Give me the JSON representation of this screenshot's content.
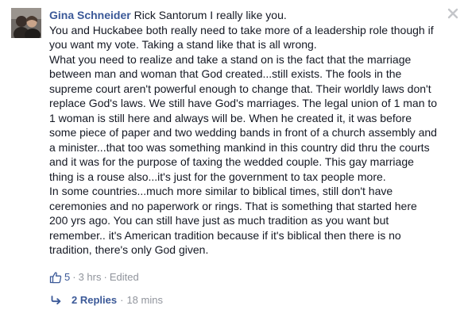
{
  "comment": {
    "author": "Gina Schneider",
    "lines": [
      "Rick Santorum I really like you.",
      "You and Huckabee both really need to take more of a leadership role though if",
      "you want my vote. Taking a stand like that is all wrong.",
      "What you need to realize and take a stand on is the fact that the marriage",
      "between man and woman that God created...still exists. The fools in the",
      "supreme court aren't powerful enough to change that. Their worldly laws don't",
      "replace God's laws. We still have God's marriages. The legal union of 1 man to",
      "1 woman is still here and always will be. When he created it, it was before",
      "some piece of paper and two wedding bands in front of a church assembly and",
      "a minister...that too was something mankind in this country did thru the courts",
      "and it was for the purpose of taxing the wedded couple. This gay marriage",
      "thing is a rouse also...it's just for the government to tax people more.",
      "In some countries...much more similar to biblical times, still don't have",
      "ceremonies and no paperwork or rings. That is something that started here",
      "200 yrs ago. You can still have just as much tradition as you want but",
      "remember.. it's American tradition because if it's biblical then there is no",
      "tradition, there's only God given."
    ],
    "likes": "5",
    "separator": "·",
    "time": "3 hrs",
    "edited": "Edited",
    "icons": {
      "like": "thumbs-up-icon",
      "close": "close-icon",
      "reply": "reply-arrow-icon"
    },
    "colors": {
      "link": "#3b5998",
      "meta": "#90949c",
      "text": "#141823"
    }
  },
  "replies": {
    "label": "2 Replies",
    "separator": "·",
    "time": "18 mins"
  }
}
